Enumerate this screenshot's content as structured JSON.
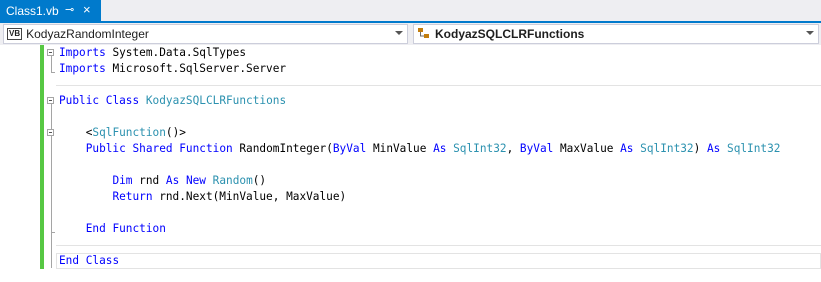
{
  "tab": {
    "title": "Class1.vb",
    "pin_glyph": "⊸",
    "close_glyph": "×"
  },
  "navbar": {
    "left": {
      "icon_text": "VB",
      "value": "KodyazRandomInteger"
    },
    "right": {
      "value": "KodyazSQLCLRFunctions"
    }
  },
  "code_lines": [
    [
      {
        "t": "Imports",
        "c": "kw"
      },
      {
        "t": " System.Data.SqlTypes",
        "c": ""
      }
    ],
    [
      {
        "t": "Imports",
        "c": "kw"
      },
      {
        "t": " Microsoft.SqlServer.Server",
        "c": ""
      }
    ],
    [],
    [
      {
        "t": "Public",
        "c": "kw"
      },
      {
        "t": " ",
        "c": ""
      },
      {
        "t": "Class",
        "c": "kw"
      },
      {
        "t": " ",
        "c": ""
      },
      {
        "t": "KodyazSQLCLRFunctions",
        "c": "ty"
      }
    ],
    [],
    [
      {
        "t": "    <",
        "c": ""
      },
      {
        "t": "SqlFunction",
        "c": "ty"
      },
      {
        "t": "()>",
        "c": ""
      }
    ],
    [
      {
        "t": "    ",
        "c": ""
      },
      {
        "t": "Public",
        "c": "kw"
      },
      {
        "t": " ",
        "c": ""
      },
      {
        "t": "Shared",
        "c": "kw"
      },
      {
        "t": " ",
        "c": ""
      },
      {
        "t": "Function",
        "c": "kw"
      },
      {
        "t": " RandomInteger(",
        "c": ""
      },
      {
        "t": "ByVal",
        "c": "kw"
      },
      {
        "t": " MinValue ",
        "c": ""
      },
      {
        "t": "As",
        "c": "kw"
      },
      {
        "t": " ",
        "c": ""
      },
      {
        "t": "SqlInt32",
        "c": "ty"
      },
      {
        "t": ", ",
        "c": ""
      },
      {
        "t": "ByVal",
        "c": "kw"
      },
      {
        "t": " MaxValue ",
        "c": ""
      },
      {
        "t": "As",
        "c": "kw"
      },
      {
        "t": " ",
        "c": ""
      },
      {
        "t": "SqlInt32",
        "c": "ty"
      },
      {
        "t": ") ",
        "c": ""
      },
      {
        "t": "As",
        "c": "kw"
      },
      {
        "t": " ",
        "c": ""
      },
      {
        "t": "SqlInt32",
        "c": "ty"
      }
    ],
    [],
    [
      {
        "t": "        ",
        "c": ""
      },
      {
        "t": "Dim",
        "c": "kw"
      },
      {
        "t": " rnd ",
        "c": ""
      },
      {
        "t": "As",
        "c": "kw"
      },
      {
        "t": " ",
        "c": ""
      },
      {
        "t": "New",
        "c": "kw"
      },
      {
        "t": " ",
        "c": ""
      },
      {
        "t": "Random",
        "c": "ty"
      },
      {
        "t": "()",
        "c": ""
      }
    ],
    [
      {
        "t": "        ",
        "c": ""
      },
      {
        "t": "Return",
        "c": "kw"
      },
      {
        "t": " rnd.Next(MinValue, MaxValue)",
        "c": ""
      }
    ],
    [],
    [
      {
        "t": "    ",
        "c": ""
      },
      {
        "t": "End",
        "c": "kw"
      },
      {
        "t": " ",
        "c": ""
      },
      {
        "t": "Function",
        "c": "kw"
      }
    ],
    [],
    [
      {
        "t": "End",
        "c": "kw"
      },
      {
        "t": " ",
        "c": ""
      },
      {
        "t": "Class",
        "c": "kw"
      }
    ]
  ]
}
